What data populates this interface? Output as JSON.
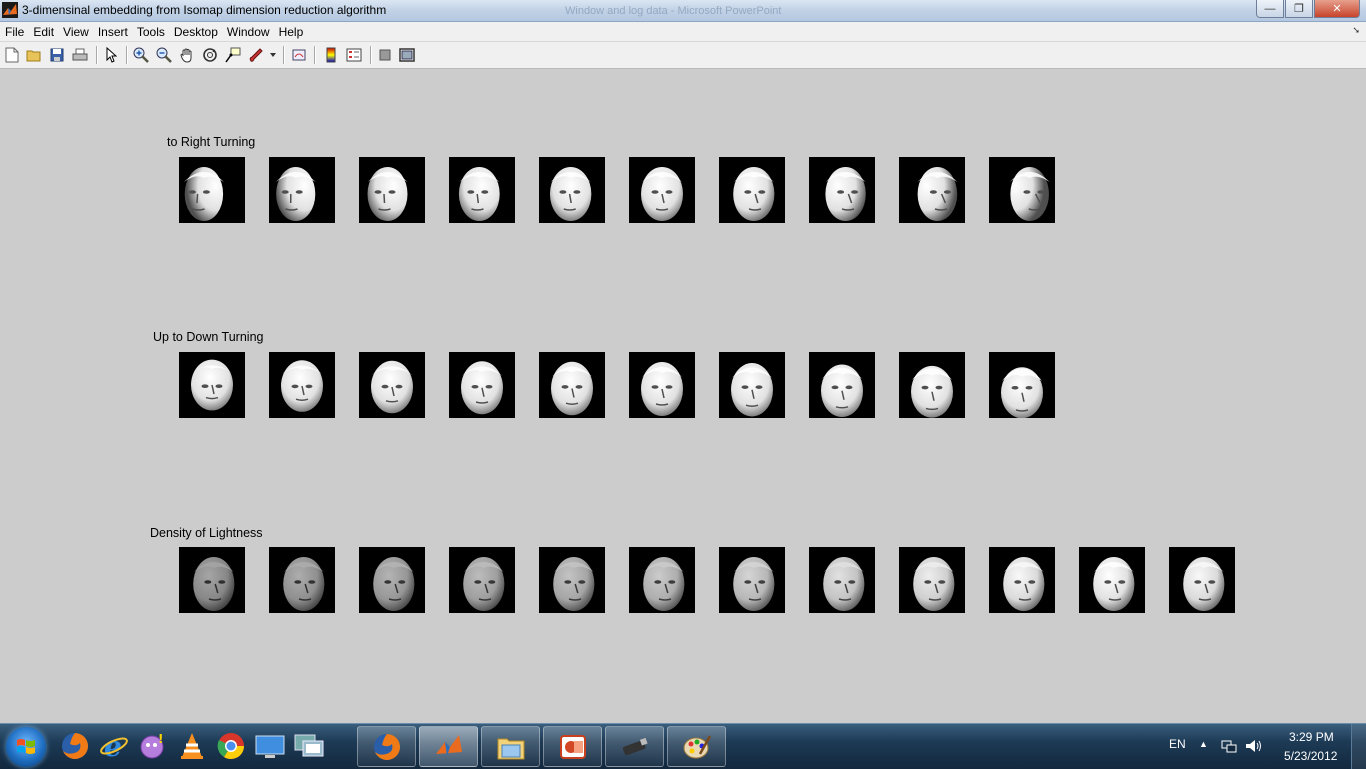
{
  "window": {
    "title": "3-dimensinal embedding from Isomap dimension reduction algorithm",
    "background_title": "Window and log data - Microsoft PowerPoint",
    "controls": {
      "minimize": "—",
      "restore": "❐",
      "close": "✕"
    }
  },
  "menu": {
    "items": [
      "File",
      "Edit",
      "View",
      "Insert",
      "Tools",
      "Desktop",
      "Window",
      "Help"
    ]
  },
  "toolbar": {
    "icons": [
      "new-figure-icon",
      "open-file-icon",
      "save-icon",
      "print-icon",
      "pointer-icon",
      "zoom-in-icon",
      "zoom-out-icon",
      "pan-hand-icon",
      "rotate-3d-icon",
      "data-cursor-icon",
      "brush-icon",
      "brush-dropdown-icon",
      "link-plot-icon",
      "colorbar-icon",
      "legend-icon",
      "hide-plot-tools-icon",
      "show-plot-tools-icon"
    ]
  },
  "figure": {
    "rows": [
      {
        "label": "to Right Turning",
        "count": 10,
        "yaw": [
          -0.9,
          -0.7,
          -0.5,
          -0.3,
          -0.15,
          0.0,
          0.2,
          0.4,
          0.6,
          0.85
        ],
        "pitch": [
          0,
          0,
          0,
          0,
          0,
          0,
          0,
          0,
          0,
          0
        ],
        "light": [
          0.9,
          0.9,
          0.9,
          0.9,
          0.9,
          0.9,
          0.9,
          0.9,
          0.9,
          0.9
        ]
      },
      {
        "label": "Up to Down Turning",
        "count": 10,
        "yaw": [
          0,
          0,
          0,
          0,
          0,
          0,
          0,
          0,
          0,
          0
        ],
        "pitch": [
          0.8,
          0.6,
          0.4,
          0.25,
          0.1,
          0.0,
          -0.15,
          -0.35,
          -0.55,
          -0.75
        ],
        "light": [
          0.9,
          0.9,
          0.9,
          0.9,
          0.9,
          0.9,
          0.9,
          0.9,
          0.9,
          0.9
        ]
      },
      {
        "label": "Density of Lightness",
        "count": 12,
        "yaw": [
          0.2,
          0.2,
          0.2,
          0.2,
          0.2,
          0.2,
          0.2,
          0.2,
          0.2,
          0.2,
          0.2,
          0.2
        ],
        "pitch": [
          0,
          0,
          0,
          0,
          0,
          0,
          0,
          0,
          0,
          0,
          0,
          0
        ],
        "light": [
          0.3,
          0.35,
          0.4,
          0.45,
          0.5,
          0.55,
          0.62,
          0.7,
          0.78,
          0.85,
          0.9,
          0.85
        ]
      }
    ]
  },
  "taskbar": {
    "pinned": [
      "start-orb-icon",
      "firefox-icon",
      "internet-explorer-icon",
      "yahoo-messenger-icon",
      "vlc-icon",
      "chrome-icon",
      "desktop-icon",
      "remote-desktop-icon"
    ],
    "running": [
      "firefox-icon",
      "matlab-icon",
      "explorer-folder-icon",
      "powerpoint-icon",
      "usb-drive-icon",
      "paint-icon"
    ],
    "active_index": 1,
    "tray": {
      "language": "EN",
      "time": "3:29 PM",
      "date": "5/23/2012"
    }
  }
}
